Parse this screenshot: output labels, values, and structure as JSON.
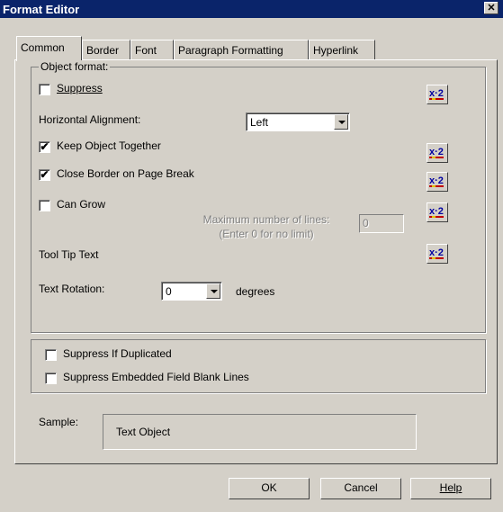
{
  "window": {
    "title": "Format Editor",
    "close_glyph": "✕"
  },
  "tabs": [
    {
      "label": "Common",
      "active": true
    },
    {
      "label": "Border"
    },
    {
      "label": "Font"
    },
    {
      "label": "Paragraph Formatting"
    },
    {
      "label": "Hyperlink"
    }
  ],
  "object_format": {
    "legend": "Object format:",
    "suppress": {
      "label": "Suppress",
      "checked": false
    },
    "horizontal_alignment": {
      "label": "Horizontal Alignment:",
      "value": "Left"
    },
    "keep_object_together": {
      "label": "Keep Object Together",
      "checked": true
    },
    "close_border": {
      "label": "Close Border on Page Break",
      "checked": true
    },
    "can_grow": {
      "label": "Can Grow",
      "checked": false
    },
    "max_lines": {
      "label_line1": "Maximum number of lines:",
      "label_line2": "(Enter 0 for no limit)",
      "value": "0"
    },
    "tool_tip_text": {
      "label": "Tool Tip Text"
    },
    "text_rotation": {
      "label": "Text Rotation:",
      "value": "0",
      "unit": "degrees"
    },
    "check_glyph": "✔"
  },
  "suppress_options": {
    "suppress_if_duplicated": {
      "label": "Suppress If Duplicated",
      "checked": false
    },
    "suppress_embedded_blank": {
      "label": "Suppress Embedded Field Blank Lines",
      "checked": false
    }
  },
  "sample": {
    "label": "Sample:",
    "text": "Text Object"
  },
  "buttons": {
    "ok": "OK",
    "cancel": "Cancel",
    "help": "Help"
  },
  "colors": {
    "title_bg": "#0a246a",
    "face": "#d4d0c8",
    "formula_icon": "#0000a0"
  }
}
